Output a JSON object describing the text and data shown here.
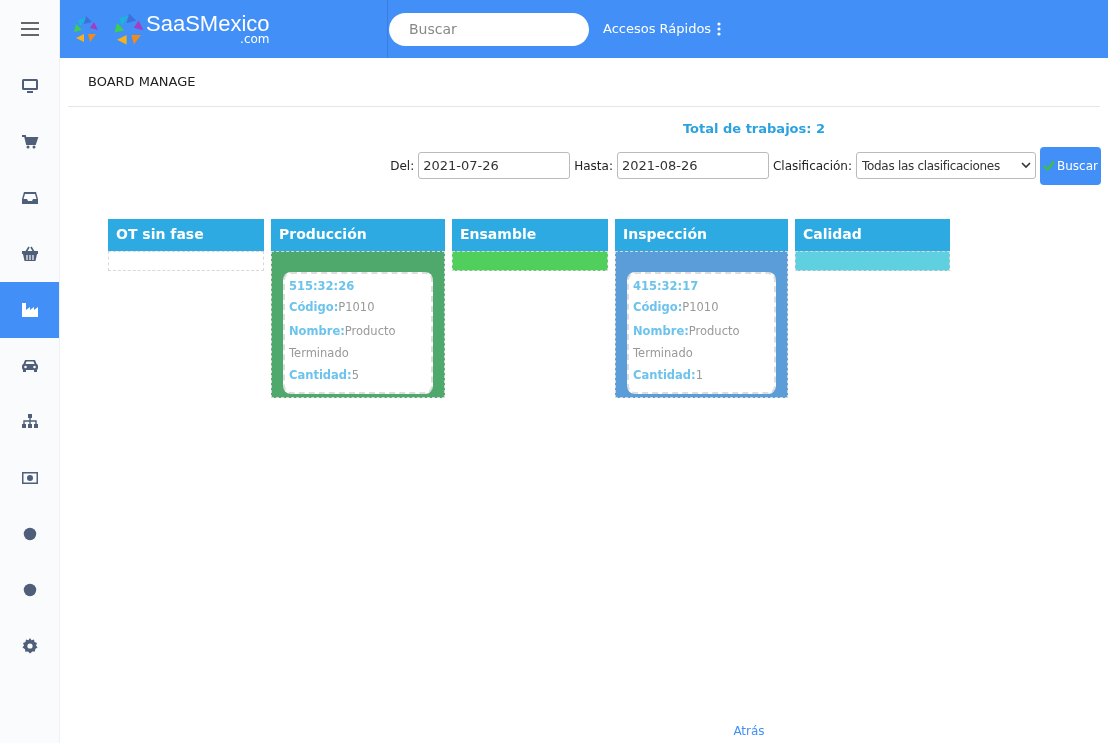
{
  "header": {
    "logo_text": "SaaSMexico",
    "logo_suffix": ".com",
    "search": {
      "placeholder": "Buscar"
    },
    "quick_access": "Accesos Rápidos"
  },
  "sidebar": {
    "items": [
      {
        "kind": "monitor",
        "selected": false
      },
      {
        "kind": "cart",
        "selected": false
      },
      {
        "kind": "inbox",
        "selected": false
      },
      {
        "kind": "basket",
        "selected": false
      },
      {
        "kind": "industry",
        "selected": true
      },
      {
        "kind": "car",
        "selected": false
      },
      {
        "kind": "sitemap",
        "selected": false
      },
      {
        "kind": "money",
        "selected": false
      },
      {
        "kind": "circle",
        "selected": false
      },
      {
        "kind": "circle",
        "selected": false
      },
      {
        "kind": "gear",
        "selected": false
      }
    ]
  },
  "page_title": "BOARD MANAGE",
  "total": "Total de trabajos: 2",
  "filters": {
    "from_label": "Del:",
    "from_value": "2021-07-26",
    "to_label": "Hasta:",
    "to_value": "2021-08-26",
    "class_label": "Clasificación:",
    "class_value": "Todas las clasificaciones",
    "button": "Buscar"
  },
  "board": {
    "columns": [
      {
        "title": "OT sin fase",
        "color": "#ffffff"
      },
      {
        "title": "Producción",
        "color": "#50a96c",
        "cards": [
          {
            "time": "515:32:26",
            "fields": [
              {
                "label": "Código:",
                "value": "P1010"
              },
              {
                "label": "Nombre:",
                "value": "Producto Terminado"
              },
              {
                "label": "Cantidad:",
                "value": "5"
              }
            ]
          }
        ]
      },
      {
        "title": "Ensamble",
        "color": "#51cf5c"
      },
      {
        "title": "Inspección",
        "color": "#5a9dd9",
        "cards": [
          {
            "time": "415:32:17",
            "fields": [
              {
                "label": "Código:",
                "value": "P1010"
              },
              {
                "label": "Nombre:",
                "value": "Producto Terminado"
              },
              {
                "label": "Cantidad:",
                "value": "1"
              }
            ]
          }
        ]
      },
      {
        "title": "Calidad",
        "color": "#5fd0df"
      }
    ]
  },
  "back_link": "Atrás"
}
